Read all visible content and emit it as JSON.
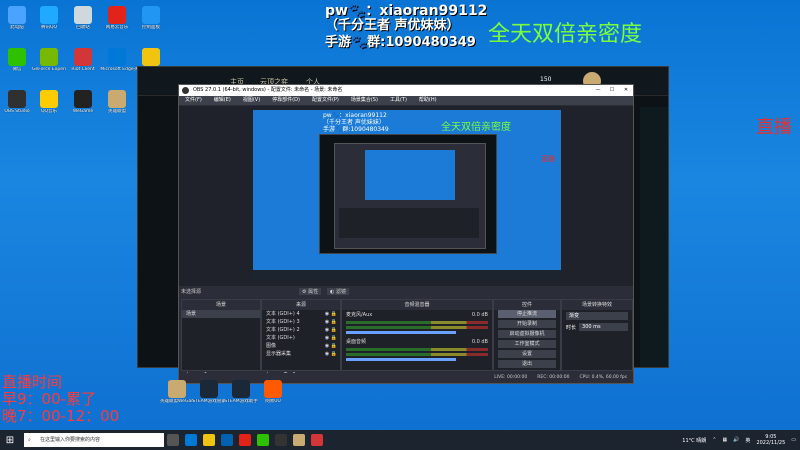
{
  "overlay": {
    "line1": "pw🐾：xiaoran99112",
    "line2": "（千分王者 声优妹妹）",
    "line3": "手游🐾群:1090480349",
    "banner": "全天双倍亲密度",
    "live_right": "直播",
    "schedule_title": "直播时间",
    "schedule_am": "早9：00-累了",
    "schedule_pm": "晚7：00-12：00"
  },
  "desktop": {
    "icons": [
      {
        "label": "此电脑",
        "color": "#4aa3ff"
      },
      {
        "label": "腾讯QQ",
        "color": "#1faaff"
      },
      {
        "label": "回收站",
        "color": "#cfd8dc"
      },
      {
        "label": "网易云音乐",
        "color": "#e2231a"
      },
      {
        "label": "控制面板",
        "color": "#2196f3"
      },
      {
        "label": "微信",
        "color": "#2dc100"
      },
      {
        "label": "GeForce Experience",
        "color": "#76b900"
      },
      {
        "label": "Riot Client",
        "color": "#d13639"
      },
      {
        "label": "Microsoft Edge",
        "color": "#0078d7"
      },
      {
        "label": "英雄联盟WeGame",
        "color": "#f1c40f"
      },
      {
        "label": "OBS Studio",
        "color": "#303030"
      },
      {
        "label": "QQ音乐",
        "color": "#ffcc00"
      },
      {
        "label": "WeGame",
        "color": "#222"
      },
      {
        "label": "英雄联盟",
        "color": "#c9aa71"
      }
    ],
    "taskbar_apps": [
      {
        "label": "英雄联盟WeGame版",
        "color": "#c9aa71"
      },
      {
        "label": "STEAM游戏管家",
        "color": "#1b2838"
      },
      {
        "label": "STEAM游戏助手",
        "color": "#1b2838"
      },
      {
        "label": "网易UU",
        "color": "#ff5a00"
      }
    ]
  },
  "lol_client": {
    "title_tabs": [
      "主页",
      "云顶之弈",
      "个人"
    ],
    "currency": "150"
  },
  "obs": {
    "title": "OBS 27.0.1 (64-bit, windows) - 配置文件: 未命名 - 场景: 未命名",
    "menus": [
      "文件(F)",
      "编辑(E)",
      "视图(V)",
      "停靠部件(D)",
      "配置文件(P)",
      "场景集合(S)",
      "工具(T)",
      "帮助(H)"
    ],
    "window_controls": [
      "—",
      "☐",
      "✕"
    ],
    "no_source": "未选择源",
    "properties_btn": "属性",
    "filters_btn": "滤镜",
    "docks": {
      "scenes": {
        "title": "场景",
        "items": [
          "场景"
        ]
      },
      "sources": {
        "title": "来源",
        "items": [
          "文本 (GDI+) 4",
          "文本 (GDI+) 3",
          "文本 (GDI+) 2",
          "文本 (GDI+)",
          "图像",
          "显示器采集"
        ]
      },
      "mixer": {
        "title": "音频混音器",
        "channels": [
          {
            "name": "麦克风/Aux",
            "db": "0.0 dB"
          },
          {
            "name": "桌面音频",
            "db": "0.0 dB"
          }
        ]
      },
      "controls": {
        "title": "控件",
        "buttons": [
          "停止推流",
          "开始录制",
          "启动虚拟摄像机",
          "工作室模式",
          "设置",
          "退出"
        ]
      },
      "transitions": {
        "title": "场景转换特效",
        "type": "渐变",
        "duration_label": "时长",
        "duration": "300 ms"
      }
    },
    "status": {
      "live": "LIVE: 00:00:00",
      "rec": "REC: 00:00:00",
      "cpu": "CPU: 0.4%, 60.00 fps"
    }
  },
  "taskbar": {
    "search_placeholder": "在这里输入你要搜索的内容",
    "weather": "11°C 晴朗",
    "ime": "英",
    "time": "9:05",
    "date": "2022/11/25"
  }
}
